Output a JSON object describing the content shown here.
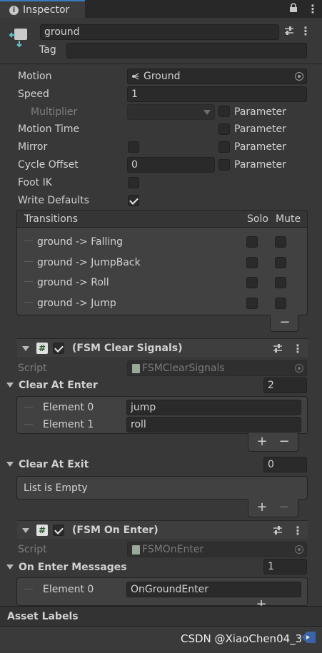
{
  "tab": {
    "title": "Inspector"
  },
  "object": {
    "name": "ground",
    "tag_label": "Tag",
    "tag_value": ""
  },
  "state": {
    "motion_label": "Motion",
    "motion_value": "Ground",
    "speed_label": "Speed",
    "speed_value": "1",
    "multiplier_label": "Multiplier",
    "multiplier_value": "",
    "motion_time_label": "Motion Time",
    "mirror_label": "Mirror",
    "cycle_offset_label": "Cycle Offset",
    "cycle_offset_value": "0",
    "foot_ik_label": "Foot IK",
    "write_defaults_label": "Write Defaults",
    "parameter_label": "Parameter"
  },
  "transitions": {
    "header": "Transitions",
    "solo_label": "Solo",
    "mute_label": "Mute",
    "items": [
      {
        "name": "ground -> Falling"
      },
      {
        "name": "ground -> JumpBack"
      },
      {
        "name": "ground -> Roll"
      },
      {
        "name": "ground -> Jump"
      }
    ],
    "remove_symbol": "−"
  },
  "clear_signals": {
    "title": "(FSM Clear Signals)",
    "script_label": "Script",
    "script_value": "FSMClearSignals",
    "enter_label": "Clear At Enter",
    "enter_count": "2",
    "enter_items": [
      {
        "label": "Element 0",
        "value": "jump"
      },
      {
        "label": "Element 1",
        "value": "roll"
      }
    ],
    "exit_label": "Clear At Exit",
    "exit_count": "0",
    "empty_label": "List is Empty"
  },
  "on_enter": {
    "title": "(FSM On Enter)",
    "script_label": "Script",
    "script_value": "FSMOnEnter",
    "messages_label": "On Enter Messages",
    "messages_count": "1",
    "items": [
      {
        "label": "Element 0",
        "value": "OnGroundEnter"
      }
    ]
  },
  "footer": {
    "asset_labels": "Asset Labels"
  },
  "watermark": "CSDN @XiaoChen04_3",
  "list_buttons": {
    "add": "+",
    "remove": "−"
  },
  "colors": {
    "panel_bg": "#383838",
    "field_bg": "#2a2a2a",
    "accent_teal": "#5fc7c7"
  }
}
